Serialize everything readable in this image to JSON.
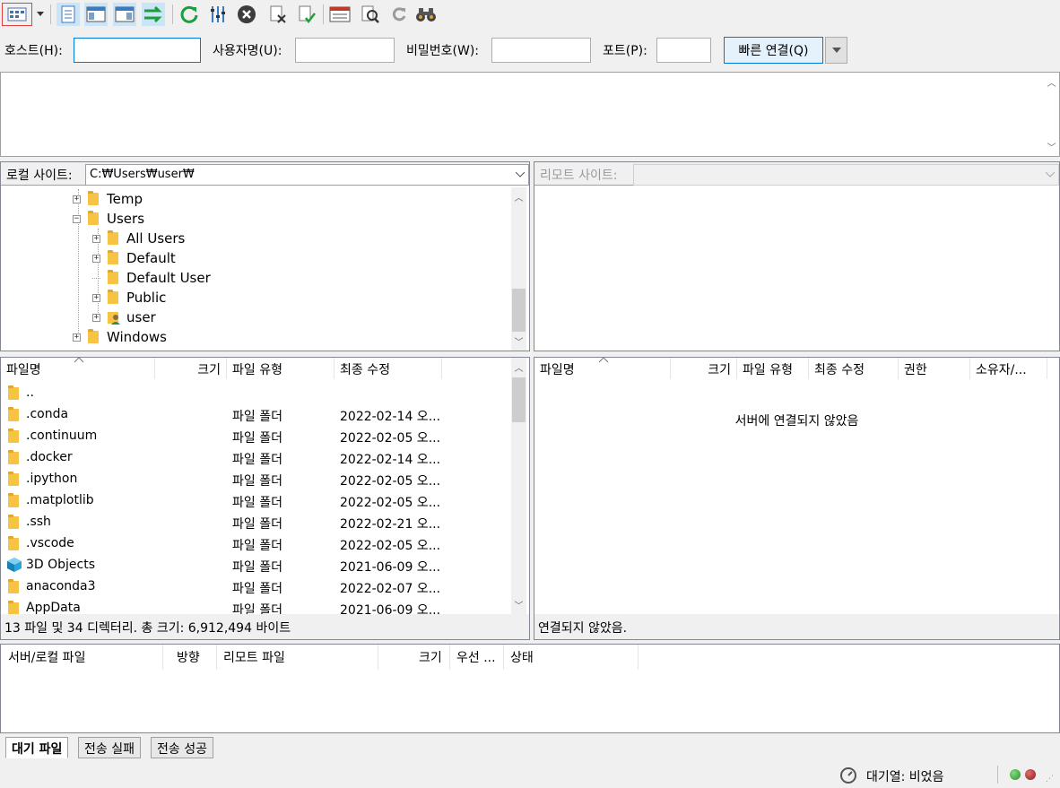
{
  "quickconnect": {
    "host_label": "호스트(H):",
    "host_value": "",
    "user_label": "사용자명(U):",
    "user_value": "",
    "pass_label": "비밀번호(W):",
    "pass_value": "",
    "port_label": "포트(P):",
    "port_value": "",
    "connect_label": "빠른 연결(Q)"
  },
  "local": {
    "site_label": "로컬 사이트:",
    "path": "C:₩Users₩user₩",
    "tree": [
      {
        "label": "Temp",
        "expander": "+"
      },
      {
        "label": "Users",
        "expander": "−"
      },
      {
        "label": "All Users",
        "expander": "+"
      },
      {
        "label": "Default",
        "expander": "+"
      },
      {
        "label": "Default User",
        "expander": ""
      },
      {
        "label": "Public",
        "expander": "+"
      },
      {
        "label": "user",
        "expander": "+"
      },
      {
        "label": "Windows",
        "expander": "+"
      }
    ],
    "columns": {
      "name": "파일명",
      "size": "크기",
      "type": "파일 유형",
      "modified": "최종 수정"
    },
    "files": [
      {
        "name": "..",
        "type": "",
        "modified": ""
      },
      {
        "name": ".conda",
        "type": "파일 폴더",
        "modified": "2022-02-14 오..."
      },
      {
        "name": ".continuum",
        "type": "파일 폴더",
        "modified": "2022-02-05 오..."
      },
      {
        "name": ".docker",
        "type": "파일 폴더",
        "modified": "2022-02-14 오..."
      },
      {
        "name": ".ipython",
        "type": "파일 폴더",
        "modified": "2022-02-05 오..."
      },
      {
        "name": ".matplotlib",
        "type": "파일 폴더",
        "modified": "2022-02-05 오..."
      },
      {
        "name": ".ssh",
        "type": "파일 폴더",
        "modified": "2022-02-21 오..."
      },
      {
        "name": ".vscode",
        "type": "파일 폴더",
        "modified": "2022-02-05 오..."
      },
      {
        "name": "3D Objects",
        "type": "파일 폴더",
        "modified": "2021-06-09 오..."
      },
      {
        "name": "anaconda3",
        "type": "파일 폴더",
        "modified": "2022-02-07 오..."
      },
      {
        "name": "AppData",
        "type": "파일 폴더",
        "modified": "2021-06-09 오..."
      }
    ],
    "status": "13 파일 및 34 디렉터리. 총 크기: 6,912,494 바이트"
  },
  "remote": {
    "site_label": "리모트 사이트:",
    "path": "",
    "columns": {
      "name": "파일명",
      "size": "크기",
      "type": "파일 유형",
      "modified": "최종 수정",
      "perm": "권한",
      "owner": "소유자/..."
    },
    "empty_message": "서버에 연결되지 않았음",
    "status": "연결되지 않았음."
  },
  "queue": {
    "columns": {
      "server_local": "서버/로컬 파일",
      "direction": "방향",
      "remote_file": "리모트 파일",
      "size": "크기",
      "priority": "우선 ...",
      "status": "상태"
    },
    "tabs": [
      "대기 파일",
      "전송 실패",
      "전송 성공"
    ]
  },
  "statusbar": {
    "queue_text": "대기열: 비었음"
  },
  "colors": {
    "accent": "#0078d7",
    "folder": "#f6c343",
    "led_green": "#2e8b2e",
    "led_red": "#8b1a1a"
  }
}
